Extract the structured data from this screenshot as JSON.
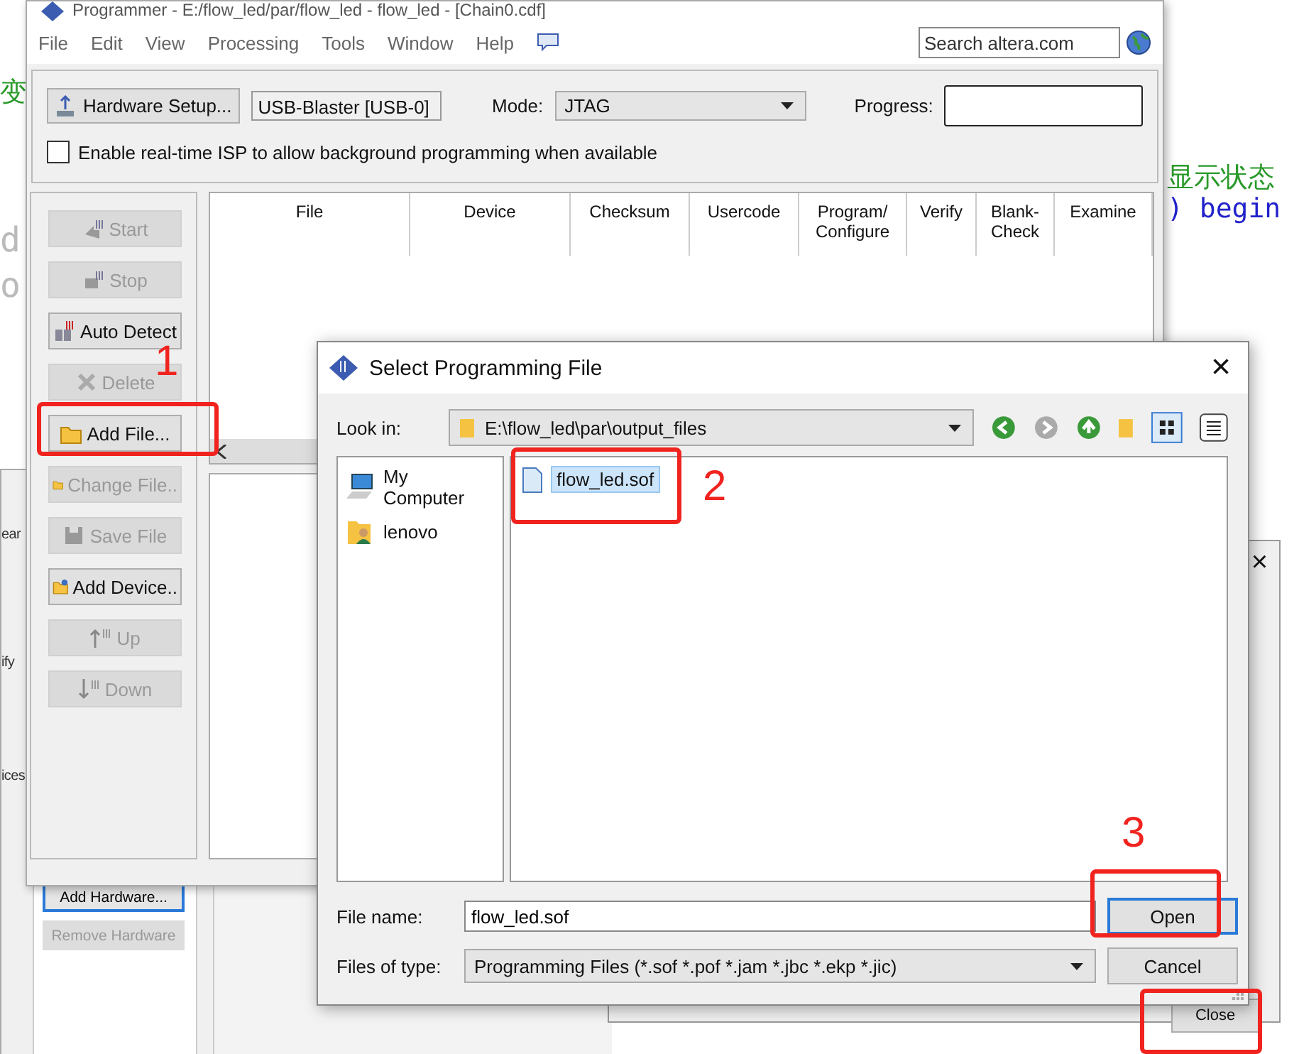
{
  "background_texts": [
    {
      "kind": "green",
      "text": "变"
    },
    {
      "kind": "gray",
      "text": "d"
    },
    {
      "kind": "gray",
      "text": "o"
    },
    {
      "kind": "green",
      "text": "显示状态"
    },
    {
      "kind": "blue",
      "text": ") begin"
    }
  ],
  "hardware_window": {
    "fragments": [
      "ear",
      "ify",
      "ices"
    ],
    "buttons": [
      {
        "label": "Add Hardware...",
        "disabled": false,
        "focused": true
      },
      {
        "label": "Remove Hardware",
        "disabled": true,
        "focused": false
      }
    ]
  },
  "programmer": {
    "title": "Programmer - E:/flow_led/par/flow_led - flow_led - [Chain0.cdf]",
    "menu": [
      "File",
      "Edit",
      "View",
      "Processing",
      "Tools",
      "Window",
      "Help"
    ],
    "search": {
      "placeholder": "Search altera.com"
    },
    "hardware_setup": "Hardware Setup...",
    "hardware": "USB-Blaster [USB-0]",
    "mode_label": "Mode:",
    "mode": "JTAG",
    "progress_label": "Progress:",
    "isp": {
      "label": "Enable real-time ISP to allow background programming when available",
      "checked": false
    },
    "actions": [
      {
        "label": "Start",
        "disabled": true
      },
      {
        "label": "Stop",
        "disabled": true
      },
      {
        "label": "Auto Detect",
        "disabled": false
      },
      {
        "label": "Delete",
        "disabled": true
      },
      {
        "label": "Add File...",
        "disabled": false
      },
      {
        "label": "Change File..",
        "disabled": true
      },
      {
        "label": "Save File",
        "disabled": true
      },
      {
        "label": "Add Device..",
        "disabled": false
      },
      {
        "label": "Up",
        "disabled": true
      },
      {
        "label": "Down",
        "disabled": true
      }
    ],
    "columns": [
      "File",
      "Device",
      "Checksum",
      "Usercode",
      "Program/\nConfigure",
      "Verify",
      "Blank-\nCheck",
      "Examine"
    ]
  },
  "other_window": {
    "close_glyph": "×",
    "button": "Close"
  },
  "dialog": {
    "title": "Select Programming File",
    "close_glyph": "×",
    "look_in_label": "Look in:",
    "look_in": "E:\\flow_led\\par\\output_files",
    "places": [
      {
        "label": "My Computer",
        "kind": "computer"
      },
      {
        "label": "lenovo",
        "kind": "user"
      }
    ],
    "files": [
      {
        "name": "flow_led.sof",
        "selected": true
      }
    ],
    "file_name_label": "File name:",
    "file_name": "flow_led.sof",
    "type_label": "Files of type:",
    "type": "Programming Files (*.sof *.pof *.jam *.jbc *.ekp *.jic)",
    "buttons": [
      "Open",
      "Cancel"
    ]
  },
  "annotation_labels": [
    "1",
    "2",
    "3"
  ]
}
